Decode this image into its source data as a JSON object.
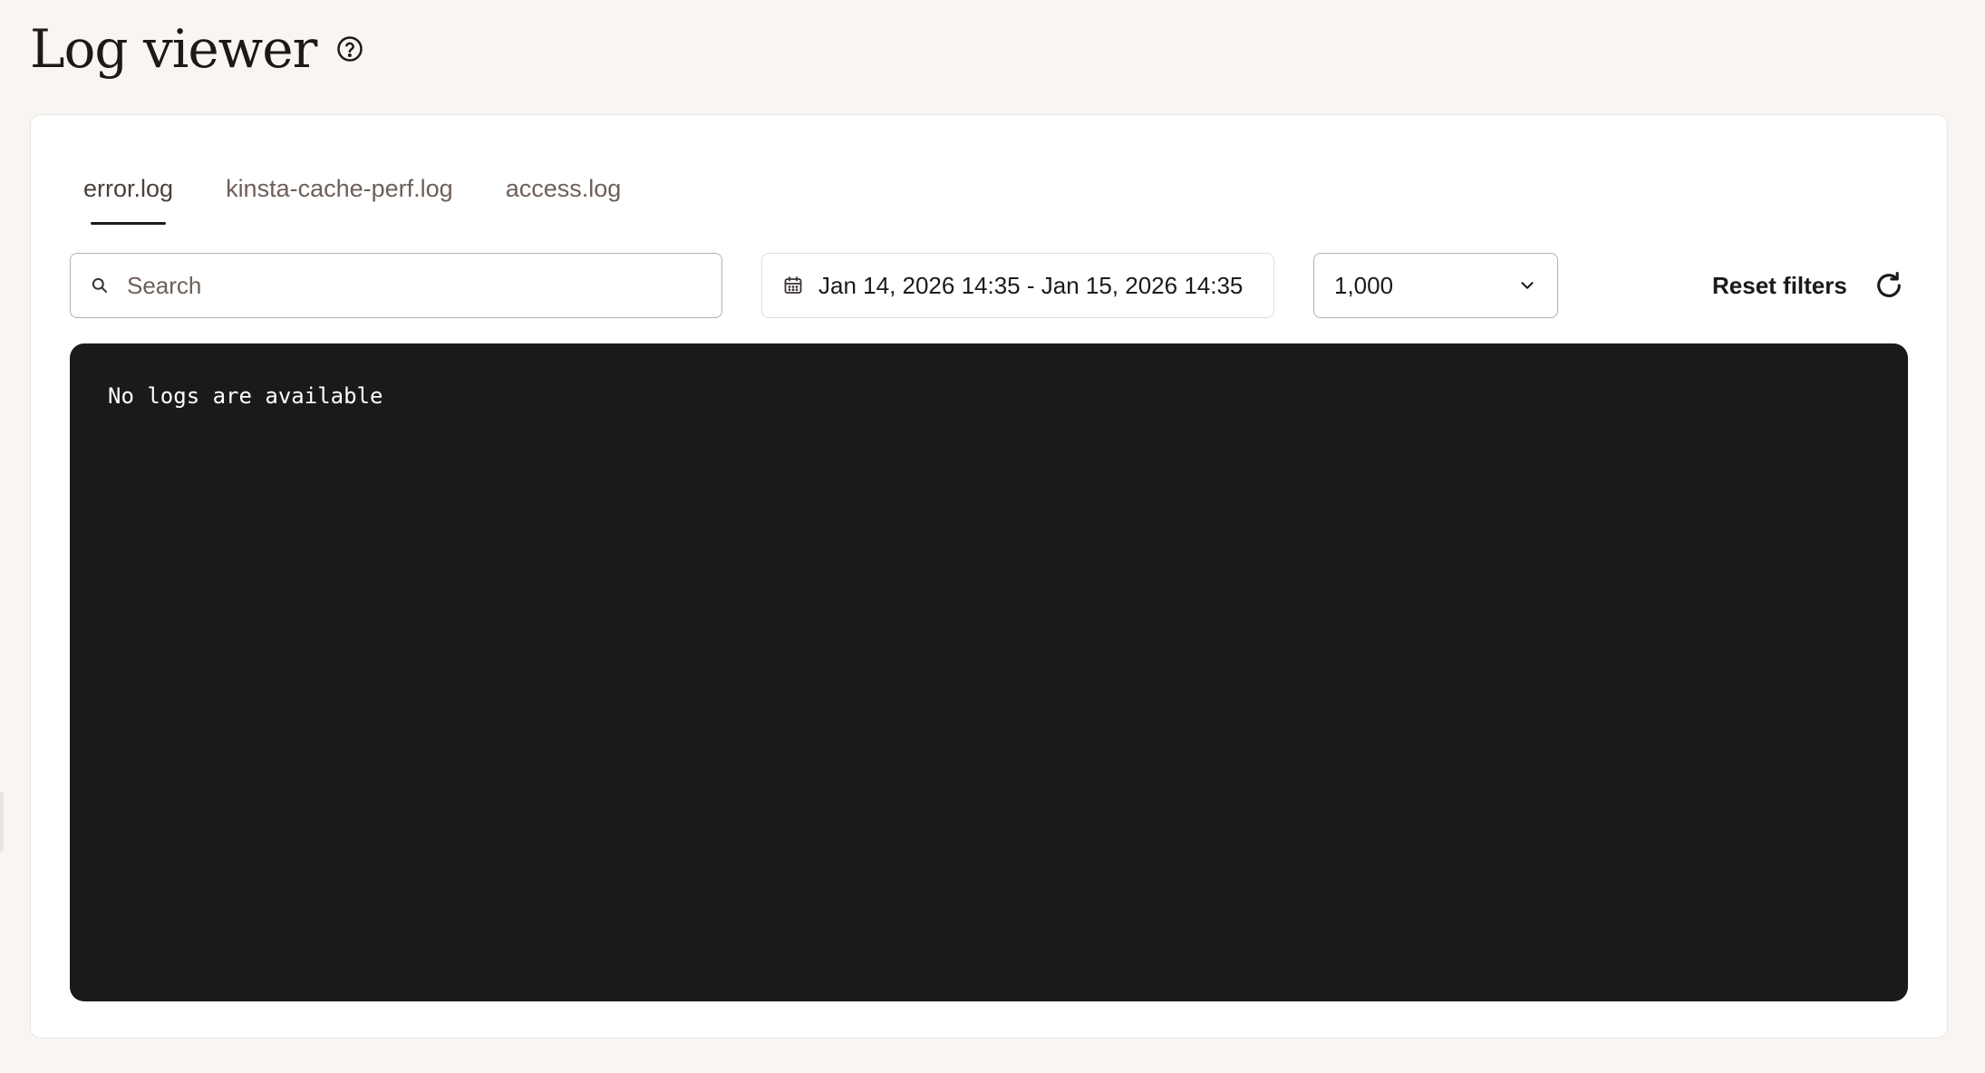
{
  "header": {
    "title": "Log viewer",
    "help_icon": "question-circle-icon"
  },
  "tabs": [
    {
      "label": "error.log",
      "active": true
    },
    {
      "label": "kinsta-cache-perf.log",
      "active": false
    },
    {
      "label": "access.log",
      "active": false
    }
  ],
  "filters": {
    "search": {
      "placeholder": "Search",
      "value": "",
      "icon": "search-icon"
    },
    "date_range": {
      "label": "Jan 14, 2026 14:35 - Jan 15, 2026 14:35",
      "icon": "calendar-icon"
    },
    "limit": {
      "value": "1,000",
      "icon": "chevron-down-icon"
    },
    "reset_label": "Reset filters",
    "refresh_icon": "refresh-icon"
  },
  "log_panel": {
    "empty_message": "No logs are available"
  },
  "colors": {
    "page_background": "#f8f5f2",
    "card_background": "#ffffff",
    "log_background": "#1b1a1a",
    "text_primary": "#1c1a19",
    "text_muted": "#6e5f58"
  }
}
